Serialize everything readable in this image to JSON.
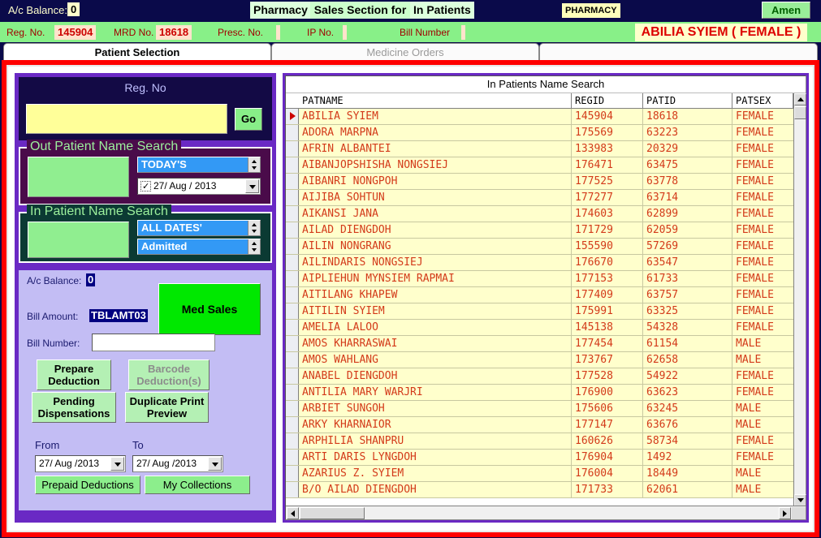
{
  "topbar": {
    "ac_balance_label": "A/c Balance:",
    "ac_balance_value": "0",
    "label_pharmacy": "Pharmacy",
    "label_sales_section": "Sales Section for",
    "label_in_patients": "In Patients",
    "label_pharmacy_badge": "PHARMACY",
    "amen_button": "Amen"
  },
  "fields": {
    "reg_no_label": "Reg. No.",
    "reg_no_value": "145904",
    "mrd_no_label": "MRD No.",
    "mrd_no_value": "18618",
    "presc_no_label": "Presc. No.",
    "presc_no_value": "",
    "ip_no_label": "IP No.",
    "ip_no_value": "",
    "bill_number_label": "Bill Number",
    "bill_number_value": "",
    "patient_name_header": "ABILIA SYIEM ( FEMALE )"
  },
  "tabs": {
    "active": "Patient Selection",
    "inactive": "Medicine Orders"
  },
  "left_panel": {
    "regno": {
      "title": "Reg. No",
      "input_value": "",
      "go_button": "Go"
    },
    "out_patient": {
      "legend": "Out Patient Name Search",
      "name_value": "",
      "range_value": "TODAY'S",
      "date_value": "27/ Aug / 2013"
    },
    "in_patient": {
      "legend": "In Patient Name Search",
      "name_value": "",
      "range_value": "ALL DATES'",
      "status_value": "Admitted"
    },
    "bill": {
      "ac_balance_label": "A/c Balance:",
      "ac_balance_value": "0",
      "bill_amount_label": "Bill Amount:",
      "bill_amount_value": "TBLAMT03",
      "bill_number_label": "Bill Number:",
      "bill_number_value": "",
      "med_sales_button": "Med Sales",
      "prepare_deduction_button": "Prepare Deduction",
      "barcode_deduction_button": "Barcode Deduction(s)",
      "pending_dispensations_button": "Pending Dispensations",
      "duplicate_print_preview_button": "Duplicate Print Preview",
      "from_label": "From",
      "to_label": "To",
      "from_date": "27/ Aug /2013",
      "to_date": "27/ Aug /2013",
      "prepaid_deductions_button": "Prepaid Deductions",
      "my_collections_button": "My Collections"
    }
  },
  "grid": {
    "title": "In Patients Name Search",
    "columns": [
      "PATNAME",
      "REGID",
      "PATID",
      "PATSEX"
    ],
    "rows": [
      {
        "selected": true,
        "patname": "ABILIA SYIEM",
        "regid": "145904",
        "patid": "18618",
        "patsex": "FEMALE"
      },
      {
        "selected": false,
        "patname": "ADORA MARPNA",
        "regid": "175569",
        "patid": "63223",
        "patsex": "FEMALE"
      },
      {
        "selected": false,
        "patname": "AFRIN ALBANTEI",
        "regid": "133983",
        "patid": "20329",
        "patsex": "FEMALE"
      },
      {
        "selected": false,
        "patname": "AIBANJOPSHISHA NONGSIEJ",
        "regid": "176471",
        "patid": "63475",
        "patsex": "FEMALE"
      },
      {
        "selected": false,
        "patname": "AIBANRI NONGPOH",
        "regid": "177525",
        "patid": "63778",
        "patsex": "FEMALE"
      },
      {
        "selected": false,
        "patname": "AIJIBA SOHTUN",
        "regid": "177277",
        "patid": "63714",
        "patsex": "FEMALE"
      },
      {
        "selected": false,
        "patname": "AIKANSI JANA",
        "regid": "174603",
        "patid": "62899",
        "patsex": "FEMALE"
      },
      {
        "selected": false,
        "patname": "AILAD DIENGDOH",
        "regid": "171729",
        "patid": "62059",
        "patsex": "FEMALE"
      },
      {
        "selected": false,
        "patname": "AILIN NONGRANG",
        "regid": "155590",
        "patid": "57269",
        "patsex": "FEMALE"
      },
      {
        "selected": false,
        "patname": "AILINDARIS NONGSIEJ",
        "regid": "176670",
        "patid": "63547",
        "patsex": "FEMALE"
      },
      {
        "selected": false,
        "patname": "AIPLIEHUN MYNSIEM RAPMAI",
        "regid": "177153",
        "patid": "61733",
        "patsex": "FEMALE"
      },
      {
        "selected": false,
        "patname": "AITILANG KHAPEW",
        "regid": "177409",
        "patid": "63757",
        "patsex": "FEMALE"
      },
      {
        "selected": false,
        "patname": "AITILIN SYIEM",
        "regid": "175991",
        "patid": "63325",
        "patsex": "FEMALE"
      },
      {
        "selected": false,
        "patname": "AMELIA LALOO",
        "regid": "145138",
        "patid": "54328",
        "patsex": "FEMALE"
      },
      {
        "selected": false,
        "patname": "AMOS KHARRASWAI",
        "regid": "177454",
        "patid": "61154",
        "patsex": "MALE"
      },
      {
        "selected": false,
        "patname": "AMOS WAHLANG",
        "regid": "173767",
        "patid": "62658",
        "patsex": "MALE"
      },
      {
        "selected": false,
        "patname": "ANABEL DIENGDOH",
        "regid": "177528",
        "patid": "54922",
        "patsex": "FEMALE"
      },
      {
        "selected": false,
        "patname": "ANTILIA MARY WARJRI",
        "regid": "176900",
        "patid": "63623",
        "patsex": "FEMALE"
      },
      {
        "selected": false,
        "patname": "ARBIET SUNGOH",
        "regid": "175606",
        "patid": "63245",
        "patsex": "MALE"
      },
      {
        "selected": false,
        "patname": "ARKY KHARNAIOR",
        "regid": "177147",
        "patid": "63676",
        "patsex": "MALE"
      },
      {
        "selected": false,
        "patname": "ARPHILIA SHANPRU",
        "regid": "160626",
        "patid": "58734",
        "patsex": "FEMALE"
      },
      {
        "selected": false,
        "patname": "ARTI DARIS LYNGDOH",
        "regid": "176904",
        "patid": "1492",
        "patsex": "FEMALE"
      },
      {
        "selected": false,
        "patname": "AZARIUS Z. SYIEM",
        "regid": "176004",
        "patid": "18449",
        "patsex": "MALE"
      },
      {
        "selected": false,
        "patname": "B/O AILAD DIENGDOH",
        "regid": "171733",
        "patid": "62061",
        "patsex": "MALE"
      }
    ]
  },
  "colors": {
    "frame_red": "#ff0000",
    "panel_purple": "#6a29c4",
    "grid_row_bg": "#ffffcc",
    "grid_text": "#d33a1a",
    "green_bar": "#88f088"
  }
}
